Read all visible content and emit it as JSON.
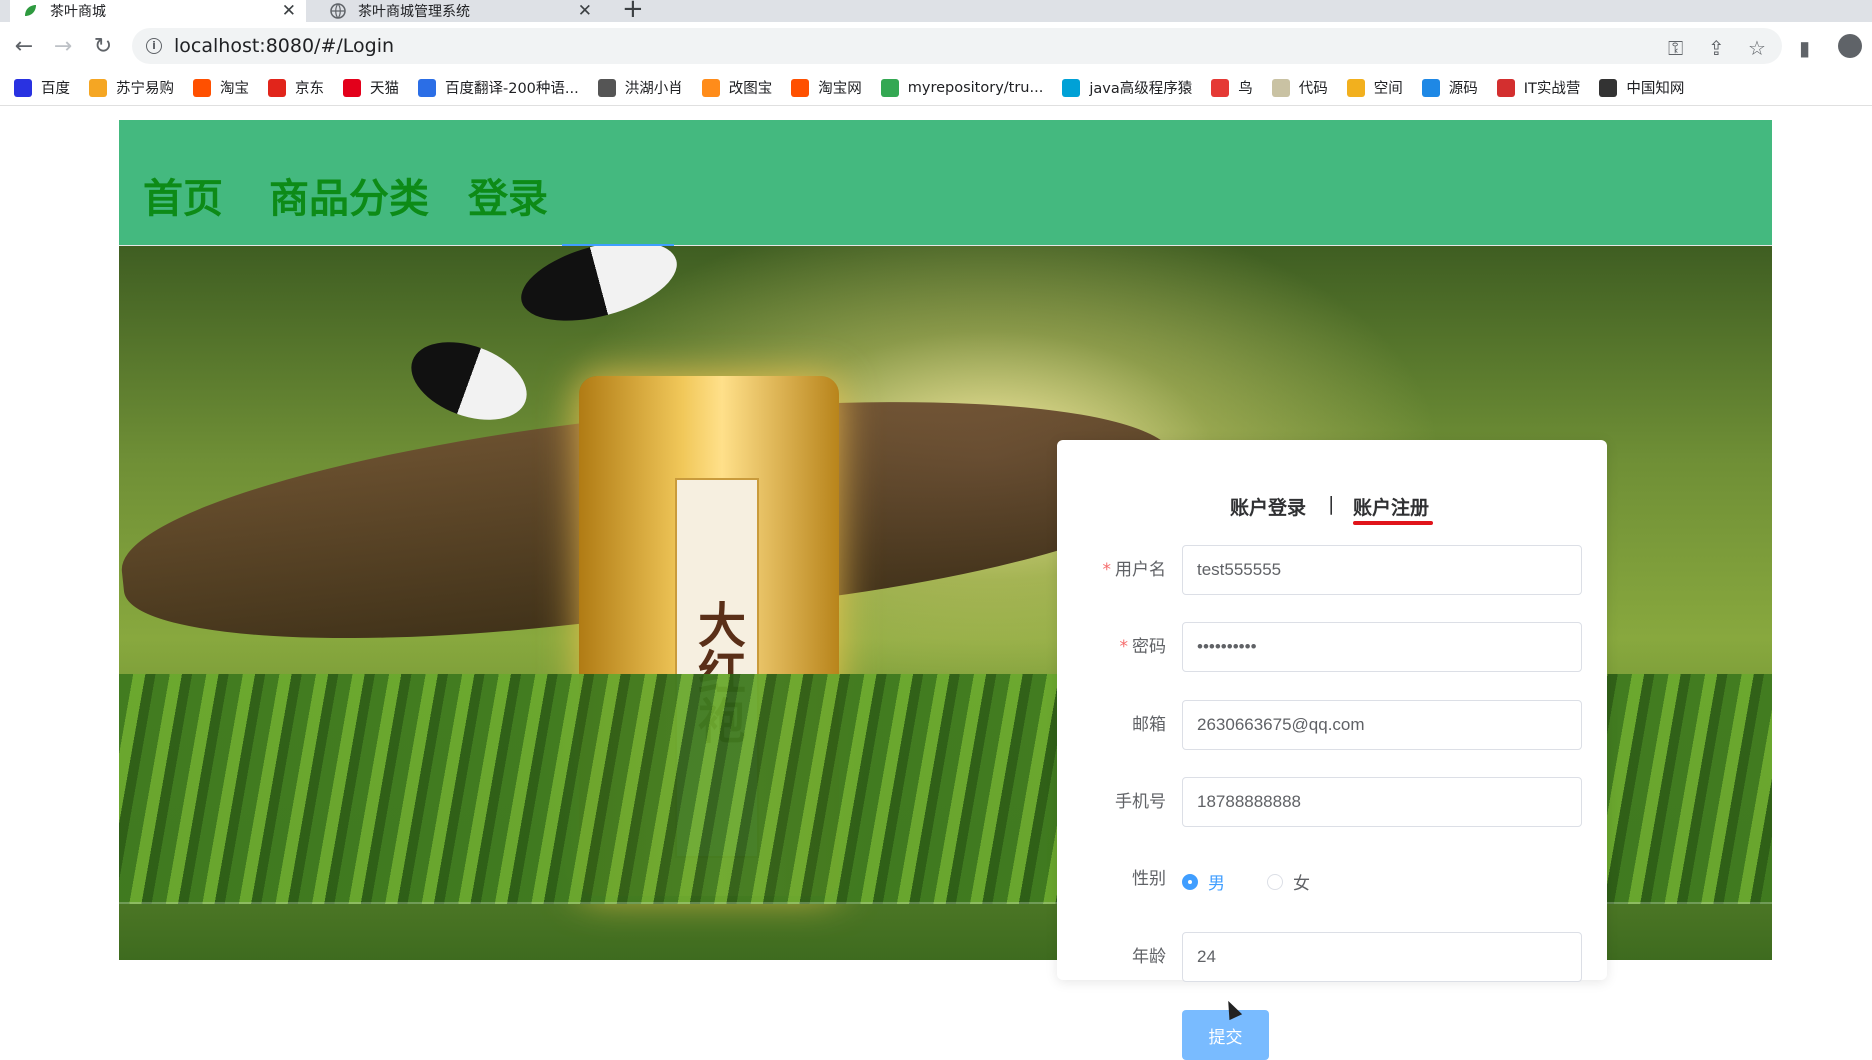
{
  "browser": {
    "tabs": [
      {
        "title": "茶叶商城",
        "active": true
      },
      {
        "title": "茶叶商城管理系统",
        "active": false
      }
    ],
    "url": "localhost:8080/#/Login",
    "bookmarks": [
      {
        "label": "百度",
        "icon": "baidu-icon",
        "color": "#2932e1"
      },
      {
        "label": "苏宁易购",
        "icon": "suning-icon",
        "color": "#f5a623"
      },
      {
        "label": "淘宝",
        "icon": "taobao-icon",
        "color": "#ff5000"
      },
      {
        "label": "京东",
        "icon": "jd-icon",
        "color": "#e1251b"
      },
      {
        "label": "天猫",
        "icon": "tmall-icon",
        "color": "#e3001b"
      },
      {
        "label": "百度翻译-200种语...",
        "icon": "translate-icon",
        "color": "#2b6ee6"
      },
      {
        "label": "洪湖小肖",
        "icon": "wing-icon",
        "color": "#555555"
      },
      {
        "label": "改图宝",
        "icon": "gaitubao-icon",
        "color": "#ff8c1a"
      },
      {
        "label": "淘宝网",
        "icon": "taobao-icon",
        "color": "#ff5000"
      },
      {
        "label": "myrepository/tru...",
        "icon": "chrome-icon",
        "color": "#34a853"
      },
      {
        "label": "java高级程序猿",
        "icon": "bilibili-icon",
        "color": "#00a1d6"
      },
      {
        "label": "鸟",
        "icon": "bird-icon",
        "color": "#e53935"
      },
      {
        "label": "代码",
        "icon": "code-icon",
        "color": "#c9c2a3"
      },
      {
        "label": "空间",
        "icon": "qzone-icon",
        "color": "#f2b01e"
      },
      {
        "label": "源码",
        "icon": "fish-icon",
        "color": "#1e88e5"
      },
      {
        "label": "IT实战营",
        "icon": "it-icon",
        "color": "#d32f2f"
      },
      {
        "label": "中国知网",
        "icon": "cnki-icon",
        "color": "#333333"
      }
    ]
  },
  "header": {
    "nav": [
      "首页",
      "商品分类",
      "登录"
    ],
    "bg_color": "#44b97f",
    "text_color": "#0d8b17"
  },
  "banner": {
    "product_text": "大红袍"
  },
  "form": {
    "tab_login": "账户登录",
    "separator": "|",
    "tab_register": "账户注册",
    "username_label": "用户名",
    "username_value": "test555555",
    "password_label": "密码",
    "password_value": "1234567890",
    "email_label": "邮箱",
    "email_value": "2630663675@qq.com",
    "phone_label": "手机号",
    "phone_value": "18788888888",
    "gender_label": "性别",
    "gender_male": "男",
    "gender_female": "女",
    "gender_selected": "男",
    "age_label": "年龄",
    "age_value": "24",
    "submit_label": "提交",
    "required_mark": "*"
  }
}
